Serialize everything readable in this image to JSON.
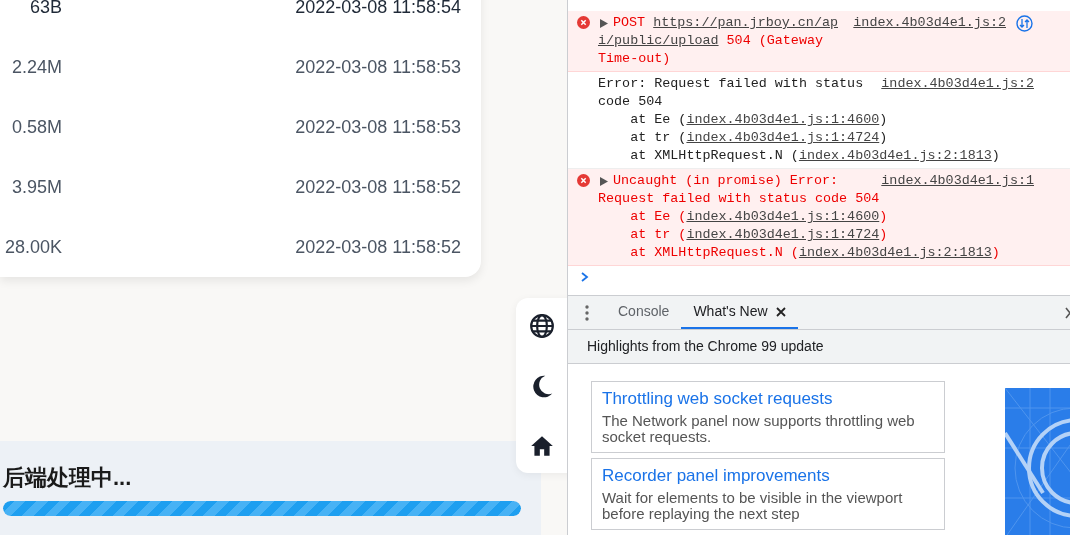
{
  "file_table": {
    "rows": [
      {
        "size": "63B",
        "date": "2022-03-08 11:58:54",
        "selected": true
      },
      {
        "size": "2.24M",
        "date": "2022-03-08 11:58:53",
        "selected": false
      },
      {
        "size": "0.58M",
        "date": "2022-03-08 11:58:53",
        "selected": false
      },
      {
        "size": "3.95M",
        "date": "2022-03-08 11:58:52",
        "selected": false
      },
      {
        "size": "28.00K",
        "date": "2022-03-08 11:58:52",
        "selected": false
      }
    ]
  },
  "side_toolbar": {
    "buttons": [
      {
        "kind": "language"
      },
      {
        "kind": "theme"
      },
      {
        "kind": "home"
      }
    ]
  },
  "processing_panel": {
    "title": "后端处理中...",
    "level": 1
  },
  "console": {
    "messages": [
      {
        "kind": "error",
        "expandable": true,
        "source": "index.4b03d4e1.js:2",
        "network_icon": true,
        "lines": [
          [
            {
              "text": "POST ",
              "link": false
            },
            {
              "text": "https://pan.jrboy.cn/ap",
              "link": true
            }
          ],
          [
            {
              "text": "i/public/upload",
              "link": true
            },
            {
              "text": " 504 (Gateway",
              "link": false
            }
          ],
          [
            {
              "text": "Time-out)",
              "link": false
            }
          ]
        ]
      },
      {
        "kind": "log",
        "expandable": false,
        "source": "index.4b03d4e1.js:2",
        "network_icon": false,
        "lines": [
          [
            {
              "text": "Error: Request failed with status",
              "link": false
            }
          ],
          [
            {
              "text": "code 504",
              "link": false
            }
          ],
          [
            {
              "text": "    at Ee (",
              "link": false
            },
            {
              "text": "index.4b03d4e1.js:1:4600",
              "link": true
            },
            {
              "text": ")",
              "link": false
            }
          ],
          [
            {
              "text": "    at tr (",
              "link": false
            },
            {
              "text": "index.4b03d4e1.js:1:4724",
              "link": true
            },
            {
              "text": ")",
              "link": false
            }
          ],
          [
            {
              "text": "    at XMLHttpRequest.N (",
              "link": false
            },
            {
              "text": "index.4b03d4e1.js:2:1813",
              "link": true
            },
            {
              "text": ")",
              "link": false
            }
          ]
        ]
      },
      {
        "kind": "error",
        "expandable": true,
        "source": "index.4b03d4e1.js:1",
        "network_icon": false,
        "lines": [
          [
            {
              "text": "Uncaught (in promise) Error:",
              "link": false
            }
          ],
          [
            {
              "text": "Request failed with status code 504",
              "link": false
            }
          ],
          [
            {
              "text": "    at Ee (",
              "link": false
            },
            {
              "text": "index.4b03d4e1.js:1:4600",
              "link": true
            },
            {
              "text": ")",
              "link": false
            }
          ],
          [
            {
              "text": "    at tr (",
              "link": false
            },
            {
              "text": "index.4b03d4e1.js:1:4724",
              "link": true
            },
            {
              "text": ")",
              "link": false
            }
          ],
          [
            {
              "text": "    at XMLHttpRequest.N (",
              "link": false
            },
            {
              "text": "index.4b03d4e1.js:2:1813",
              "link": true
            },
            {
              "text": ")",
              "link": false
            }
          ]
        ]
      }
    ]
  },
  "drawer": {
    "tabs": [
      {
        "label": "Console",
        "selected": false,
        "closable": false
      },
      {
        "label": "What's New",
        "selected": true,
        "closable": true
      }
    ],
    "subtitle": "Highlights from the Chrome 99 update",
    "cards": [
      {
        "title": "Throttling web socket requests",
        "body": "The Network panel now supports throttling web socket requests."
      },
      {
        "title": "Recorder panel improvements",
        "body": "Wait for elements to be visible in the viewport before replaying the next step"
      }
    ]
  }
}
